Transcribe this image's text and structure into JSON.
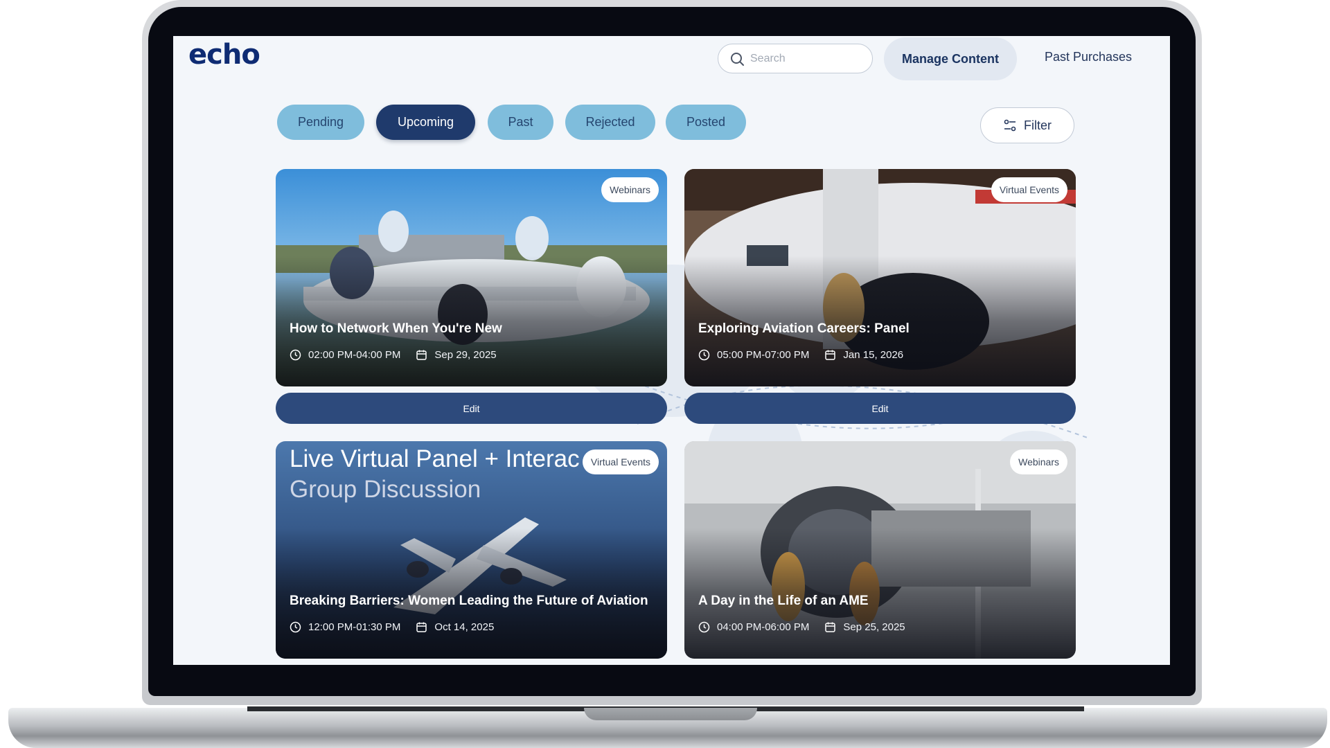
{
  "header": {
    "logo": "echo",
    "search_placeholder": "Search",
    "manage_content": "Manage Content",
    "past_purchases": "Past Purchases"
  },
  "tabs": [
    {
      "label": "Pending",
      "active": false
    },
    {
      "label": "Upcoming",
      "active": true
    },
    {
      "label": "Past",
      "active": false
    },
    {
      "label": "Rejected",
      "active": false
    },
    {
      "label": "Posted",
      "active": false
    }
  ],
  "filter_label": "Filter",
  "edit_label": "Edit",
  "cards": [
    {
      "badge": "Webinars",
      "title": "How to Network When You're New",
      "time": "02:00 PM-04:00 PM",
      "date": "Sep 29, 2025"
    },
    {
      "badge": "Virtual Events",
      "title": "Exploring Aviation Careers: Panel",
      "time": "05:00 PM-07:00 PM",
      "date": "Jan 15, 2026"
    },
    {
      "badge": "Virtual Events",
      "title": "Breaking Barriers: Women Leading the Future of Aviation",
      "time": "12:00 PM-01:30 PM",
      "date": "Oct 14, 2025",
      "overlay_line1": "Live Virtual Panel + Interac",
      "overlay_line2": "Group Discussion"
    },
    {
      "badge": "Webinars",
      "title": "A Day in the Life of an AME",
      "time": "04:00 PM-06:00 PM",
      "date": "Sep 25, 2025"
    }
  ],
  "colors": {
    "brand": "#0e2b73",
    "tab_active": "#1f3a6c",
    "tab_inactive": "#7fbddc",
    "edit_button": "#2d4a7c"
  },
  "icons": {
    "search": "search-icon",
    "filter": "filter-icon",
    "time": "clock-icon",
    "date": "calendar-icon"
  }
}
